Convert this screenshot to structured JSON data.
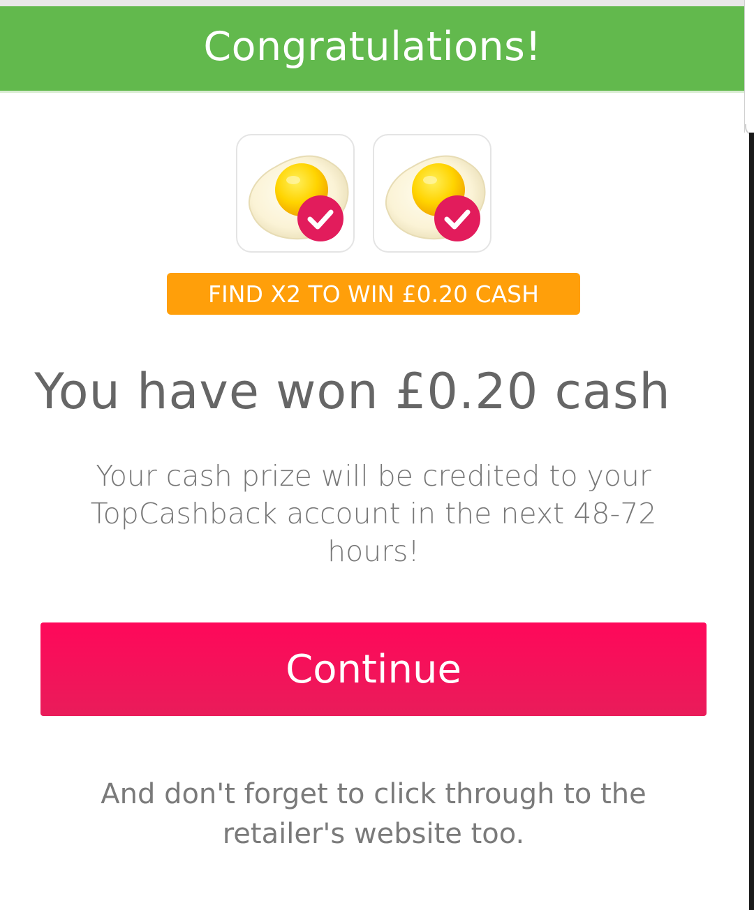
{
  "header": {
    "title": "Congratulations!"
  },
  "tiles": [
    {
      "icon": "fried-egg-icon",
      "badge": "check-badge-icon",
      "found": true
    },
    {
      "icon": "fried-egg-icon",
      "badge": "check-badge-icon",
      "found": true
    }
  ],
  "game": {
    "banner": "FIND X2 TO WIN £0.20 CASH"
  },
  "result": {
    "title": "You have won £0.20 cash",
    "message": "Your cash prize will be credited to your TopCashback account in the next 48-72 hours!"
  },
  "actions": {
    "continue_label": "Continue"
  },
  "footer": {
    "note": "And don't forget to click through to the retailer's website too."
  },
  "colors": {
    "header_green": "#62b94d",
    "banner_orange": "#ff9f0a",
    "button_pink": "#ff085a",
    "check_badge": "#e21c5c"
  }
}
